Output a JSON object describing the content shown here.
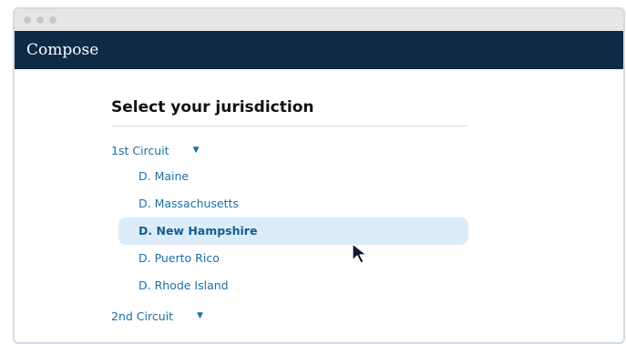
{
  "app": {
    "title": "Compose"
  },
  "jurisdiction": {
    "heading": "Select your jurisdiction",
    "circuits": [
      {
        "label": "1st Circuit",
        "expanded": true,
        "districts": [
          {
            "label": "D. Maine",
            "selected": false
          },
          {
            "label": "D. Massachusetts",
            "selected": false
          },
          {
            "label": "D. New Hampshire",
            "selected": true
          },
          {
            "label": "D. Puerto Rico",
            "selected": false
          },
          {
            "label": "D. Rhode Island",
            "selected": false
          }
        ]
      },
      {
        "label": "2nd Circuit",
        "expanded": false,
        "districts": []
      }
    ]
  },
  "icons": {
    "caret": "caret-down-icon",
    "cursor": "mouse-pointer-icon"
  },
  "colors": {
    "appbar": "#0f2a47",
    "link": "#1b6fa8",
    "selected_bg": "#dcecf9"
  }
}
